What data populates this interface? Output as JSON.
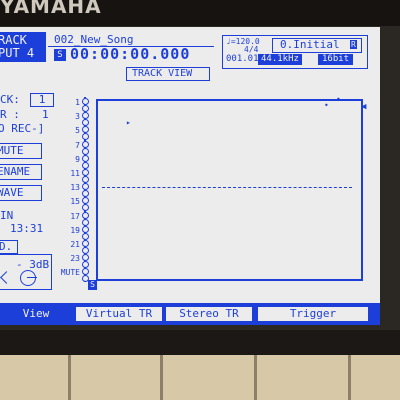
{
  "brand": "YAMAHA",
  "header": {
    "track_line1": "RACK",
    "track_line2": "PUT 4",
    "song": "002_New_Song",
    "song_marker": "S",
    "time": "00:00:00.000",
    "tempo": "♩=120.0",
    "signature": "4/4",
    "scene_name": "0.Initial",
    "scene_marker": "R",
    "location": "001.01",
    "sample_rate": "44.1kHz",
    "bit_depth": "16bit"
  },
  "view_title": "TRACK VIEW",
  "left_panel": {
    "track_label": "CK:",
    "track_value": "1",
    "vtr_label": "R :",
    "vtr_value": "1",
    "rec_label": "O REC-]",
    "mute_button": "MUTE",
    "rename_button": "ENAME",
    "wave_button": "WAVE",
    "remain_label": "IN",
    "remain_time": "13:31",
    "mode_label": "D.",
    "level_value": "- 3dB"
  },
  "track_rows": [
    "1",
    "3",
    "5",
    "7",
    "9",
    "11",
    "13",
    "15",
    "17",
    "19",
    "21",
    "23",
    "MUTE"
  ],
  "tabs": [
    {
      "label": "View",
      "active": true
    },
    {
      "label": "Virtual TR",
      "active": false
    },
    {
      "label": "Stereo TR",
      "active": false
    },
    {
      "label": "Trigger",
      "active": false
    }
  ],
  "colors": {
    "lcd_background": "#ececec",
    "lcd_ink": "#1d3fd9",
    "bezel": "#161311"
  }
}
